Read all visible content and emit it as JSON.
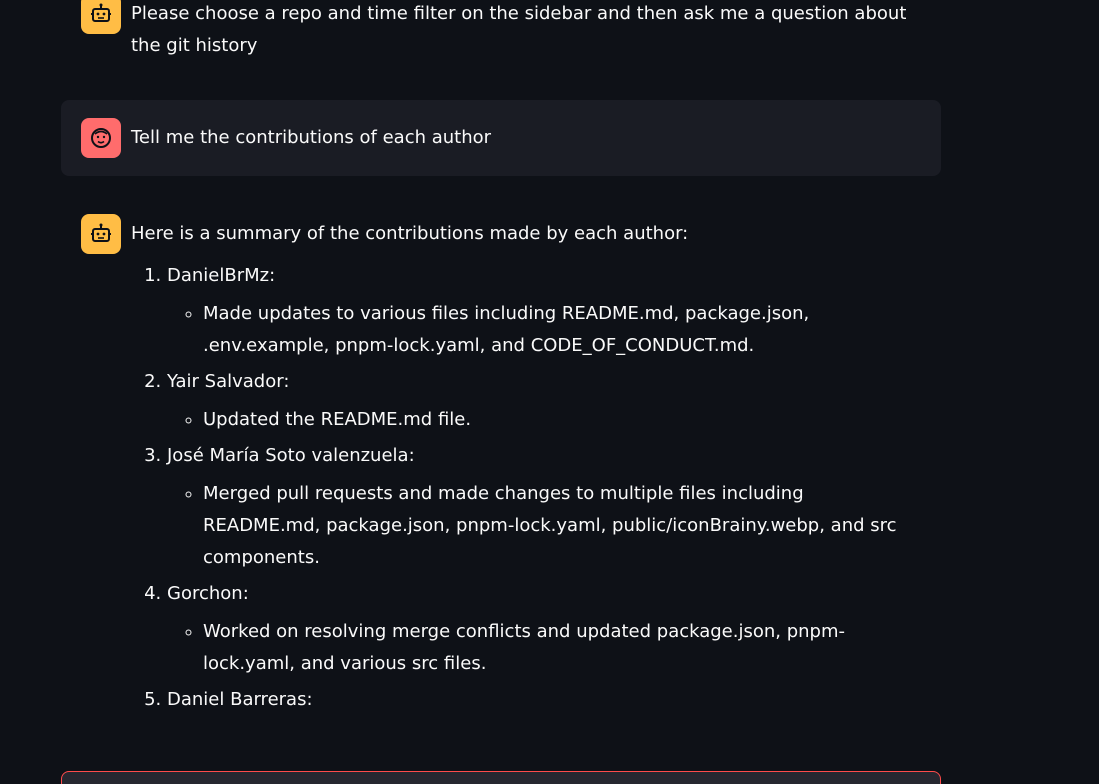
{
  "messages": [
    {
      "role": "assistant",
      "text": "Please choose a repo and time filter on the sidebar and then ask me a question about the git history"
    },
    {
      "role": "user",
      "text": "Tell me the contributions of each author"
    },
    {
      "role": "assistant",
      "intro": "Here is a summary of the contributions made by each author:",
      "authors": [
        {
          "name": "DanielBrMz:",
          "details": "Made updates to various files including README.md, package.json, .env.example, pnpm-lock.yaml, and CODE_OF_CONDUCT.md."
        },
        {
          "name": "Yair Salvador:",
          "details": "Updated the README.md file."
        },
        {
          "name": "José María Soto valenzuela:",
          "details": "Merged pull requests and made changes to multiple files including README.md, package.json, pnpm-lock.yaml, public/iconBrainy.webp, and src components."
        },
        {
          "name": "Gorchon:",
          "details": "Worked on resolving merge conflicts and updated package.json, pnpm-lock.yaml, and various src files."
        },
        {
          "name": "Daniel Barreras:"
        }
      ]
    }
  ],
  "icons": {
    "assistant": "robot-icon",
    "user": "smiley-face-icon"
  },
  "colors": {
    "background": "#0e1117",
    "user_message_bg": "#1a1c24",
    "assistant_avatar": "#ffbd45",
    "user_avatar": "#ff6c6c",
    "input_border": "#ff4b4b"
  }
}
